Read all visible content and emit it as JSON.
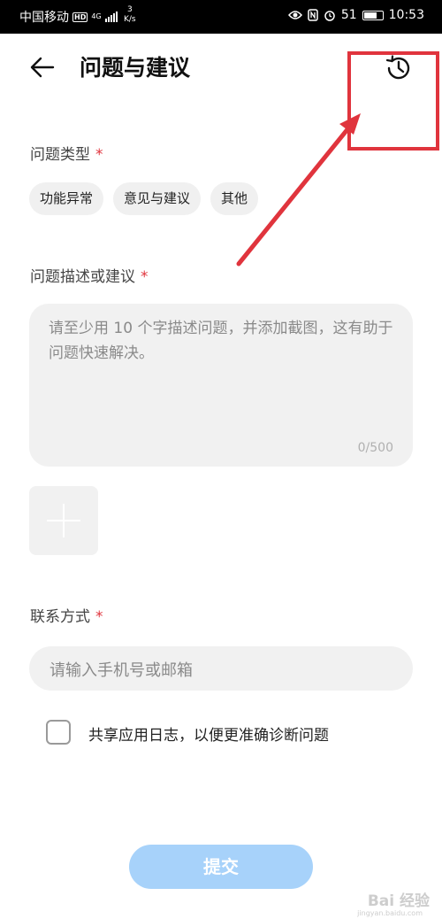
{
  "status_bar": {
    "carrier": "中国移动",
    "hd": "HD",
    "network": "4G",
    "speed_value": "3",
    "speed_unit": "K/s",
    "battery_text": "51",
    "time": "10:53"
  },
  "header": {
    "title": "问题与建议",
    "back_icon": "arrow-left-icon",
    "history_icon": "history-clock-icon"
  },
  "issue_type": {
    "label": "问题类型",
    "required_mark": "*",
    "options": [
      "功能异常",
      "意见与建议",
      "其他"
    ]
  },
  "description": {
    "label": "问题描述或建议",
    "required_mark": "*",
    "placeholder": "请至少用 10 个字描述问题，并添加截图，这有助于问题快速解决。",
    "counter": "0/500"
  },
  "attachment": {
    "icon": "plus-icon"
  },
  "contact": {
    "label": "联系方式",
    "required_mark": "*",
    "placeholder": "请输入手机号或邮箱"
  },
  "share_log": {
    "label": "共享应用日志，以便更准确诊断问题",
    "checked": false
  },
  "submit": {
    "label": "提交"
  },
  "watermark": {
    "text": "Bai 经验",
    "sub": "jingyan.baidu.com"
  },
  "colors": {
    "required": "#e0343d",
    "submit_disabled": "#a7d2fa",
    "annotation": "#e0343d",
    "field_bg": "#f1f1f1"
  }
}
